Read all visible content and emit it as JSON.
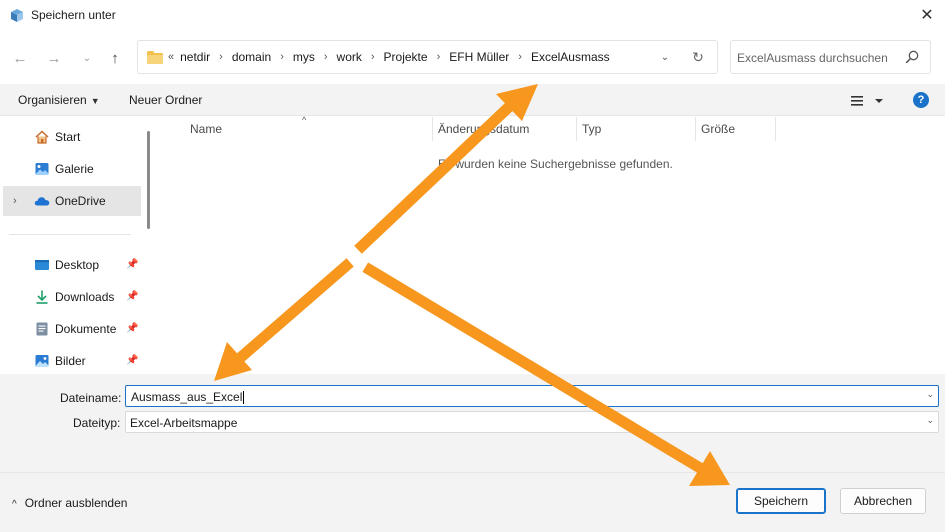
{
  "window": {
    "title": "Speichern unter",
    "close_glyph": "✕"
  },
  "nav": {
    "back_glyph": "←",
    "forward_glyph": "→",
    "recent_glyph": "⌄",
    "up_glyph": "↑"
  },
  "address": {
    "overflow": "«",
    "crumbs": [
      "netdir",
      "domain",
      "mys",
      "work",
      "Projekte",
      "EFH Müller",
      "ExcelAusmass"
    ],
    "separator": "›",
    "dropdown_glyph": "⌄",
    "refresh_glyph": "↻"
  },
  "search": {
    "placeholder": "ExcelAusmass durchsuchen"
  },
  "toolbar": {
    "organize_label": "Organisieren",
    "new_folder_label": "Neuer Ordner",
    "help_label": "?"
  },
  "sidebar": {
    "items": [
      {
        "label": "Start",
        "icon": "home-icon"
      },
      {
        "label": "Galerie",
        "icon": "gallery-icon"
      },
      {
        "label": "OneDrive",
        "icon": "onedrive-icon",
        "selected": true,
        "chevron": "›"
      },
      {
        "label": "Desktop",
        "icon": "desktop-icon",
        "pinned": true
      },
      {
        "label": "Downloads",
        "icon": "downloads-icon",
        "pinned": true
      },
      {
        "label": "Dokumente",
        "icon": "documents-icon",
        "pinned": true
      },
      {
        "label": "Bilder",
        "icon": "pictures-icon",
        "pinned": true
      }
    ]
  },
  "filelist": {
    "columns": [
      "Name",
      "Änderungsdatum",
      "Typ",
      "Größe"
    ],
    "sort_glyph": "^",
    "empty_message": "Es wurden keine Suchergebnisse gefunden."
  },
  "form": {
    "filename_label": "Dateiname:",
    "filename_value": "Ausmass_aus_Excel",
    "filetype_label": "Dateityp:",
    "filetype_value": "Excel-Arbeitsmappe",
    "drop_glyph": "⌄"
  },
  "footer": {
    "hide_folders_label": "Ordner ausblenden",
    "hide_chevron": "^",
    "save_label": "Speichern",
    "cancel_label": "Abbrechen"
  },
  "colors": {
    "accent": "#1a73c8",
    "annotation_arrow": "#f7971e",
    "panel": "#f3f3f3"
  }
}
